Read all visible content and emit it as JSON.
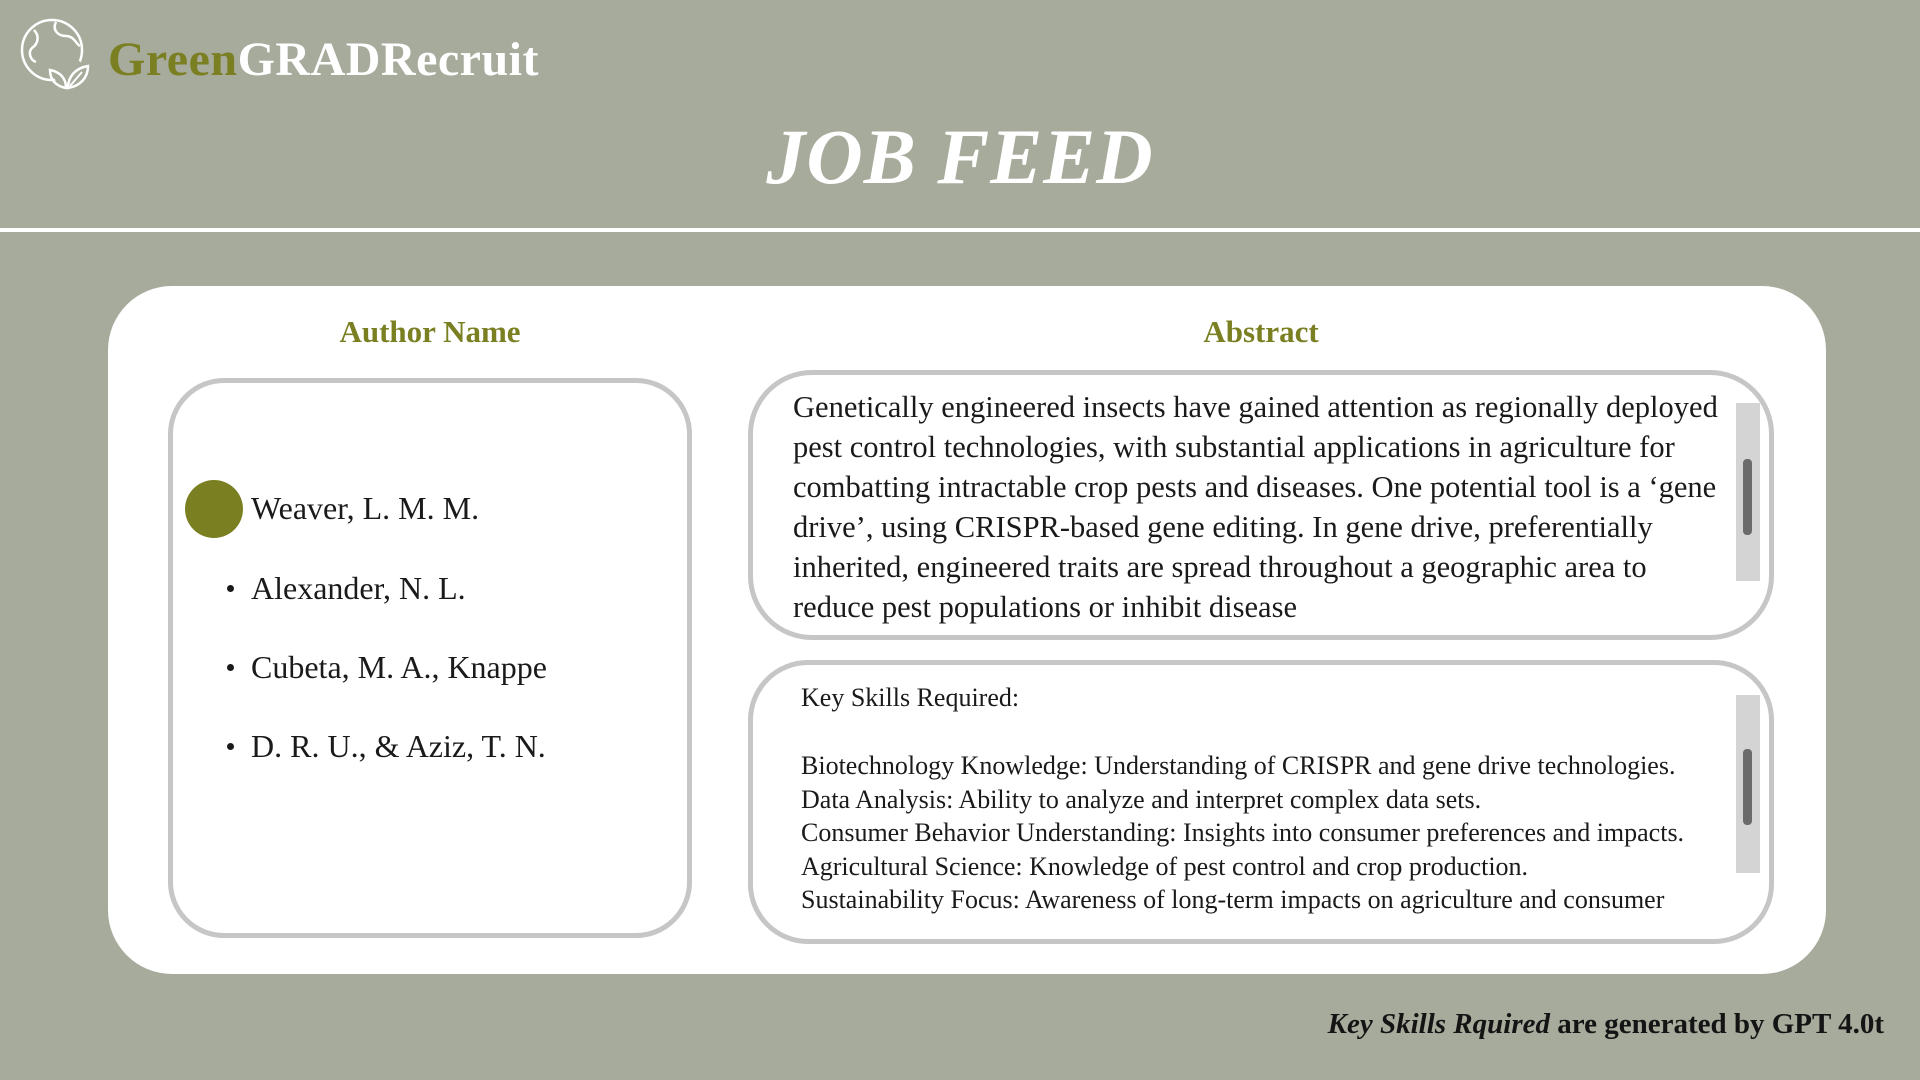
{
  "brand": {
    "part1": "Green",
    "part2": "GRADRecruit",
    "logo_icon": "globe-leaf-icon"
  },
  "page_title": "JOB FEED",
  "columns": {
    "author_header": "Author Name",
    "abstract_header": "Abstract"
  },
  "authors": [
    {
      "name": "Weaver, L. M. M.",
      "selected": true
    },
    {
      "name": "Alexander, N. L.",
      "selected": false
    },
    {
      "name": "Cubeta, M. A., Knappe",
      "selected": false
    },
    {
      "name": "D. R. U., & Aziz, T. N.",
      "selected": false
    }
  ],
  "abstract": {
    "text": "Genetically engineered insects have gained attention as regionally deployed pest control technologies, with substantial applications in agriculture for combatting intractable crop pests and diseases. One potential tool is a ‘gene drive’, using CRISPR-based gene editing. In gene drive, preferentially inherited, engineered traits are spread throughout a geographic area to reduce pest populations or inhibit disease"
  },
  "skills": {
    "title": "Key Skills Required:",
    "items": [
      "Biotechnology Knowledge: Understanding of CRISPR and gene drive technologies.",
      "Data Analysis: Ability to analyze and interpret complex data sets.",
      "Consumer Behavior Understanding: Insights into consumer preferences and impacts.",
      "Agricultural Science: Knowledge of pest control and crop production.",
      "Sustainability Focus: Awareness of long-term impacts on agriculture and consumer"
    ]
  },
  "footnote": {
    "italic_part": "Key Skills Rquired",
    "rest": " are generated by GPT 4.0t"
  },
  "colors": {
    "background": "#a7ab9c",
    "accent": "#7a7f22",
    "card": "#ffffff",
    "border": "#c6c6c6"
  }
}
